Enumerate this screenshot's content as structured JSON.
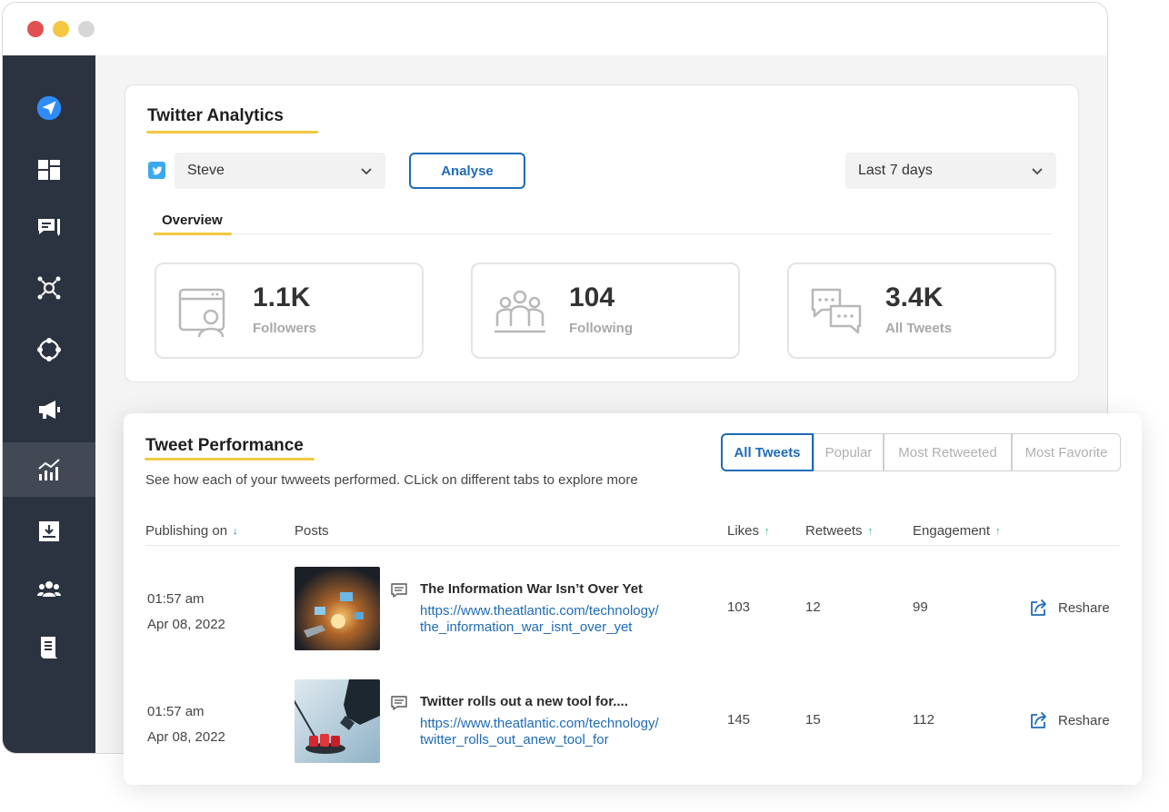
{
  "analytics": {
    "title": "Twitter Analytics",
    "account_select": "Steve",
    "analyse_label": "Analyse",
    "range_select": "Last 7 days",
    "tab_overview": "Overview",
    "stats": [
      {
        "value": "1.1K",
        "label": "Followers",
        "icon": "followers-icon"
      },
      {
        "value": "104",
        "label": "Following",
        "icon": "people-group-icon"
      },
      {
        "value": "3.4K",
        "label": "All Tweets",
        "icon": "chat-bubbles-icon"
      }
    ]
  },
  "performance": {
    "title": "Tweet Performance",
    "subtitle": "See how each of your twweets performed. CLick on different tabs to explore more",
    "tabs": [
      "All Tweets",
      "Popular",
      "Most Retweeted",
      "Most Favorite"
    ],
    "columns": {
      "publishing": "Publishing on",
      "posts": "Posts",
      "likes": "Likes",
      "retweets": "Retweets",
      "engagement": "Engagement"
    },
    "rows": [
      {
        "time": "01:57 am",
        "date": "Apr 08, 2022",
        "title": "The Information War Isn’t Over Yet",
        "link_line1": "https://www.theatlantic.com/technology/",
        "link_line2": "the_information_war_isnt_over_yet",
        "likes": "103",
        "retweets": "12",
        "engagement": "99",
        "action": "Reshare"
      },
      {
        "time": "01:57 am",
        "date": "Apr 08, 2022",
        "title": "Twitter rolls out a new tool for....",
        "link_line1": "https://www.theatlantic.com/technology/",
        "link_line2": "twitter_rolls_out_anew_tool_for",
        "likes": "145",
        "retweets": "15",
        "engagement": "112",
        "action": "Reshare"
      }
    ]
  },
  "colors": {
    "sidebar_bg": "#2c3340",
    "accent_blue": "#1f6bb6",
    "underline_yellow": "#f3c842",
    "twitter_blue": "#3ba9ee"
  }
}
